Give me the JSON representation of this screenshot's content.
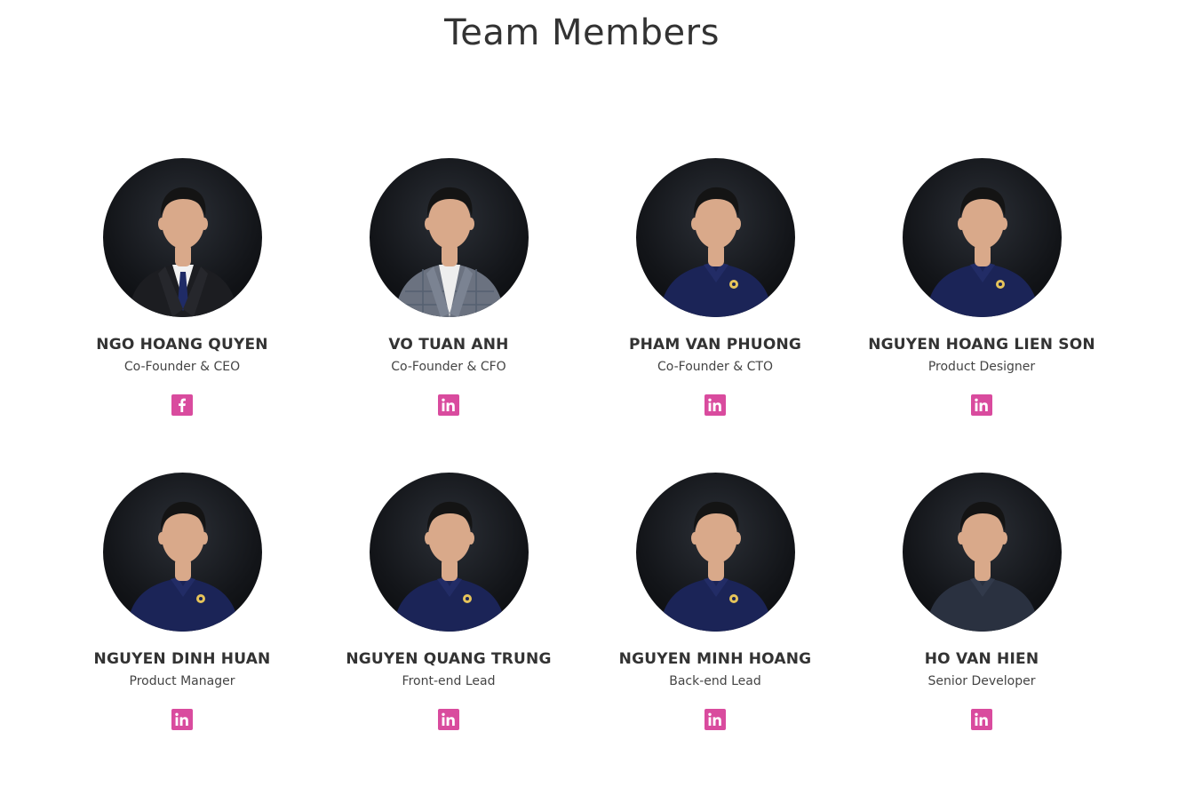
{
  "page": {
    "title": "Team Members"
  },
  "colors": {
    "social_icon_bg": "#d94b9e",
    "text_dark": "#333333"
  },
  "team": [
    {
      "name": "NGO HOANG QUYEN",
      "role": "Co-Founder & CEO",
      "social": "facebook-icon",
      "outfit": "suit-dark"
    },
    {
      "name": "VO TUAN ANH",
      "role": "Co-Founder & CFO",
      "social": "linkedin-icon",
      "outfit": "suit-gray"
    },
    {
      "name": "PHAM VAN PHUONG",
      "role": "Co-Founder & CTO",
      "social": "linkedin-icon",
      "outfit": "polo-navy"
    },
    {
      "name": "NGUYEN HOANG LIEN SON",
      "role": "Product Designer",
      "social": "linkedin-icon",
      "outfit": "polo-navy"
    },
    {
      "name": "NGUYEN DINH HUAN",
      "role": "Product Manager",
      "social": "linkedin-icon",
      "outfit": "polo-navy"
    },
    {
      "name": "NGUYEN QUANG TRUNG",
      "role": "Front-end Lead",
      "social": "linkedin-icon",
      "outfit": "polo-navy"
    },
    {
      "name": "NGUYEN MINH HOANG",
      "role": "Back-end Lead",
      "social": "linkedin-icon",
      "outfit": "polo-navy"
    },
    {
      "name": "HO VAN HIEN",
      "role": "Senior Developer",
      "social": "linkedin-icon",
      "outfit": "polo-dark"
    }
  ]
}
